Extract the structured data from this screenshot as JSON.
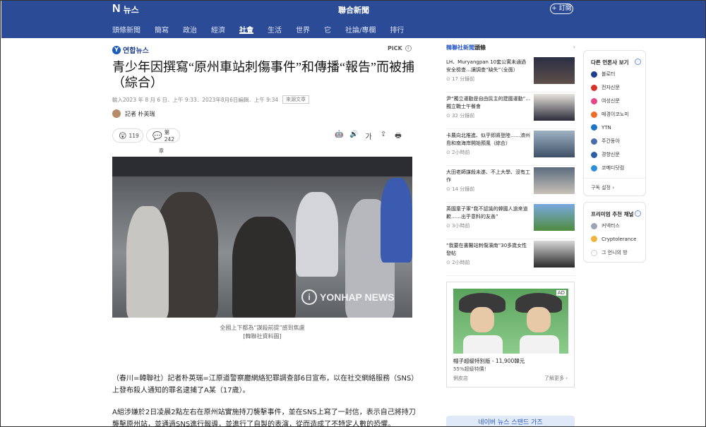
{
  "header": {
    "logo_letter": "N",
    "logo_text": "뉴스",
    "site_title": "聯合新聞",
    "subscribe_label": "+ 訂閱",
    "nav": [
      "頭條新聞",
      "簡寫",
      "政治",
      "經濟",
      "社會",
      "生活",
      "世界",
      "它",
      "社論/專欄",
      "排行"
    ],
    "active_nav": "社會"
  },
  "article": {
    "agency": "연합뉴스",
    "pick_label": "PiCK",
    "headline": "青少年因撰寫“原州車站刺傷事件”和傳播“報告”而被捕（綜合）",
    "meta": "輸入2023 年 8 月 6 日．上午 9:33．2023年8月6日編輯．上午 9:34",
    "source_tag": "來源文章",
    "reporter": "記者 朴英瑞",
    "reaction_count": "119",
    "comment_label": "第242",
    "comment_sub": "章",
    "photo_watermark": "YONHAP NEWS",
    "caption_line1": "全國上下都為“謀殺前提”感到焦慮",
    "caption_line2": "[韓聯社資料圖]",
    "paragraph1": "（春川=韓聯社）記者朴英瑞=江原道警察廳網絡犯罪調查部6日宣布，以在社交網絡服務（SNS）上發布殺人通知的罪名逮捕了A某（17歲）。",
    "paragraph2": "A組涉嫌於2日凌晨2點左右在原州站實施持刀襲擊事件，並在SNS上寫了一封信，表示自己將持刀襲擊原州站，並通過SNS進行報導，並進行了自製的表演，從而造成了不特定人數的恐懼。"
  },
  "sidebar_news": {
    "heading_blue": "韓聯社新聞",
    "heading_rest": "頭條",
    "chevron": "›",
    "items": [
      {
        "text": "LH、Muryangpan 10套公寓未通過安全檢查…讓調查“缺失”（全面）",
        "time": "17 分鐘前"
      },
      {
        "text": "尹“獨立運動是自由民主的建國運動”…獨立戰士午餐會",
        "time": "32 分鐘前"
      },
      {
        "text": "卡農向北推進、似乎即將登陸……濟州島和南海岸開始預風（綜合）",
        "time": "2小時前"
      },
      {
        "text": "大田老師謀殺未遂、不上大學、沒有工作",
        "time": "14 分鐘前"
      },
      {
        "text": "英國童子軍“我不認識的韓國人過來道歉……出乎意料的友善”",
        "time": "3小時前"
      },
      {
        "text": "“我要在書醫站刺傷濱南”30多歲女性發帖",
        "time": "2小時前"
      }
    ]
  },
  "ad": {
    "label": "AD",
    "title": "帽子超級特別版 - 11,900韓元",
    "subtitle": "55%超級特價！",
    "seller": "側皮店",
    "more": "了解更多 ›"
  },
  "bottom_banner": "네이버 뉴스 스탠드 가즈",
  "press_card": {
    "title": "다른 언론사 보기",
    "items": [
      {
        "name": "블로터",
        "color": "#1b3f8b"
      },
      {
        "name": "전자신문",
        "color": "#d6332f"
      },
      {
        "name": "여성신문",
        "color": "#e5488a"
      },
      {
        "name": "매경이코노미",
        "color": "#f06a28"
      },
      {
        "name": "YTN",
        "color": "#1f74c7"
      },
      {
        "name": "주간동아",
        "color": "#4a6ca8"
      },
      {
        "name": "경향신문",
        "color": "#2b5fa8"
      },
      {
        "name": "코메디닷컴",
        "color": "#2d8fd8"
      }
    ],
    "footer": "구독 설정 ›"
  },
  "premium_card": {
    "title": "프리미엄 추천 채널",
    "items": [
      {
        "name": "커넥터스",
        "color": "#9aa6b6"
      },
      {
        "name": "Cryptolerance",
        "color": "#f0b33c"
      },
      {
        "name": "그 언니의 방",
        "color": "#ffffff"
      }
    ]
  }
}
